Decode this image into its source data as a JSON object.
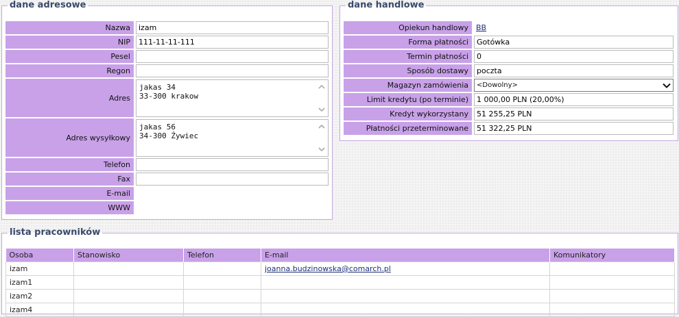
{
  "address": {
    "legend": "dane adresowe",
    "name_label": "Nazwa",
    "name_value": "izam",
    "nip_label": "NIP",
    "nip_value": "111-11-11-111",
    "pesel_label": "Pesel",
    "pesel_value": "",
    "regon_label": "Regon",
    "regon_value": "",
    "adres_label": "Adres",
    "adres_lines": [
      "jakas 34",
      "33-300 krakow"
    ],
    "ship_label": "Adres wysyłkowy",
    "ship_lines": [
      "jakas 56",
      "34-300 Żywiec"
    ],
    "phone_label": "Telefon",
    "phone_value": "",
    "fax_label": "Fax",
    "fax_value": "",
    "email_label": "E-mail",
    "www_label": "WWW"
  },
  "trade": {
    "legend": "dane handlowe",
    "rep_label": "Opiekun handlowy",
    "rep_value": "BB",
    "payform_label": "Forma płatności",
    "payform_value": "Gotówka",
    "payterm_label": "Termin płatności",
    "payterm_value": "0",
    "delivery_label": "Sposób dostawy",
    "delivery_value": "poczta",
    "warehouse_label": "Magazyn zamówienia",
    "warehouse_value": "<Dowolny>",
    "limit_label": "Limit kredytu (po terminie)",
    "limit_value": "1 000,00 PLN (20,00%)",
    "used_label": "Kredyt wykorzystany",
    "used_value": "51 255,25 PLN",
    "overdue_label": "Płatności przeterminowane",
    "overdue_value": "51 322,25 PLN"
  },
  "staff": {
    "legend": "lista pracowników",
    "columns": [
      "Osoba",
      "Stanowisko",
      "Telefon",
      "E-mail",
      "Komunikatory"
    ],
    "rows": [
      {
        "osoba": "izam",
        "stanowisko": "",
        "telefon": "",
        "email": "joanna.budzinowska@comarch.pl",
        "komunikatory": ""
      },
      {
        "osoba": "izam1",
        "stanowisko": "",
        "telefon": "",
        "email": "",
        "komunikatory": ""
      },
      {
        "osoba": "izam2",
        "stanowisko": "",
        "telefon": "",
        "email": "",
        "komunikatory": ""
      },
      {
        "osoba": "izam4",
        "stanowisko": "",
        "telefon": "",
        "email": "",
        "komunikatory": ""
      }
    ]
  }
}
